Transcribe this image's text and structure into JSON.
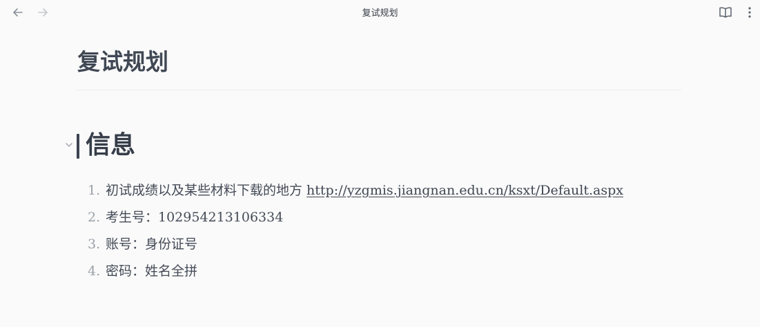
{
  "toolbar": {
    "title": "复试规划",
    "back_icon": "arrow-left-icon",
    "forward_icon": "arrow-right-icon",
    "reading_icon": "book-open-icon",
    "more_icon": "more-vertical-icon"
  },
  "note": {
    "title": "复试规划",
    "section_heading": "信息",
    "items": [
      {
        "number": "1.",
        "text": "初试成绩以及某些材料下载的地方 ",
        "link": "http://yzgmis.jiangnan.edu.cn/ksxt/Default.aspx"
      },
      {
        "number": "2.",
        "text": "考生号：102954213106334"
      },
      {
        "number": "3.",
        "text": "账号：身份证号"
      },
      {
        "number": "4.",
        "text": "密码：姓名全拼"
      }
    ]
  },
  "colors": {
    "background": "#fafafa",
    "text": "#3f4651",
    "muted": "#9aa0a8",
    "divider": "#ebebeb",
    "heading_bar": "#3b4250"
  }
}
